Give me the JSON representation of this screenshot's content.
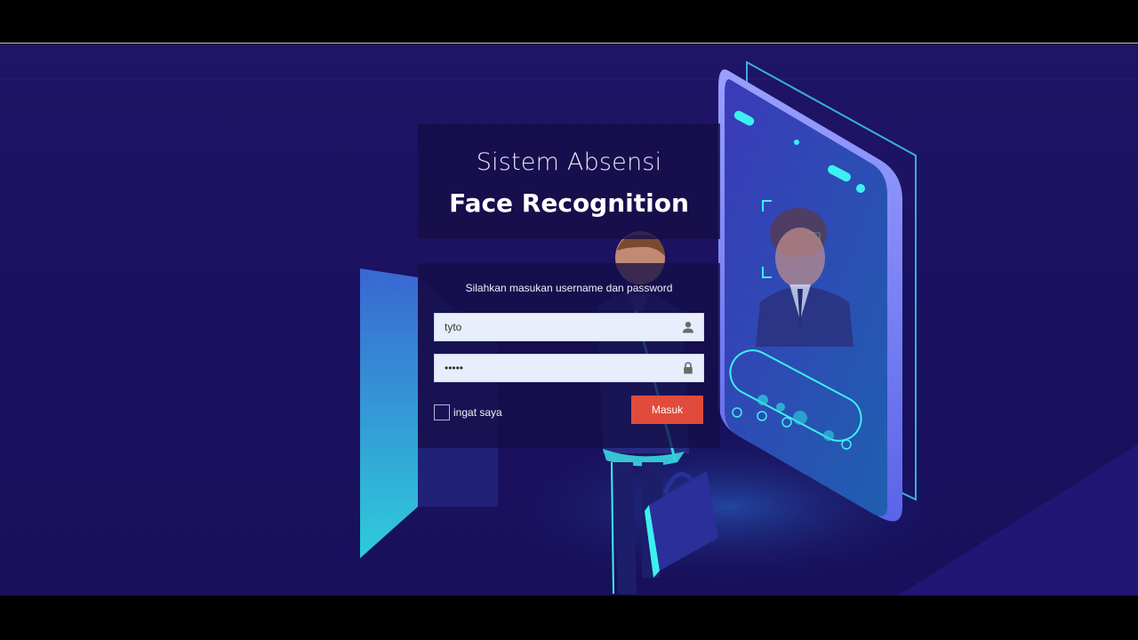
{
  "header": {
    "title_line1": "Sistem Absensi",
    "title_line2": "Face Recognition"
  },
  "login": {
    "prompt": "Silahkan masukan username dan password",
    "username_value": "tyto",
    "password_value": "•••••",
    "remember_label": "ingat saya",
    "submit_label": "Masuk"
  },
  "icons": {
    "username": "user-icon",
    "password": "lock-icon"
  },
  "colors": {
    "background": "#1b1260",
    "panel": "#160e48",
    "button": "#e04b3b",
    "field": "#e8eefc"
  }
}
